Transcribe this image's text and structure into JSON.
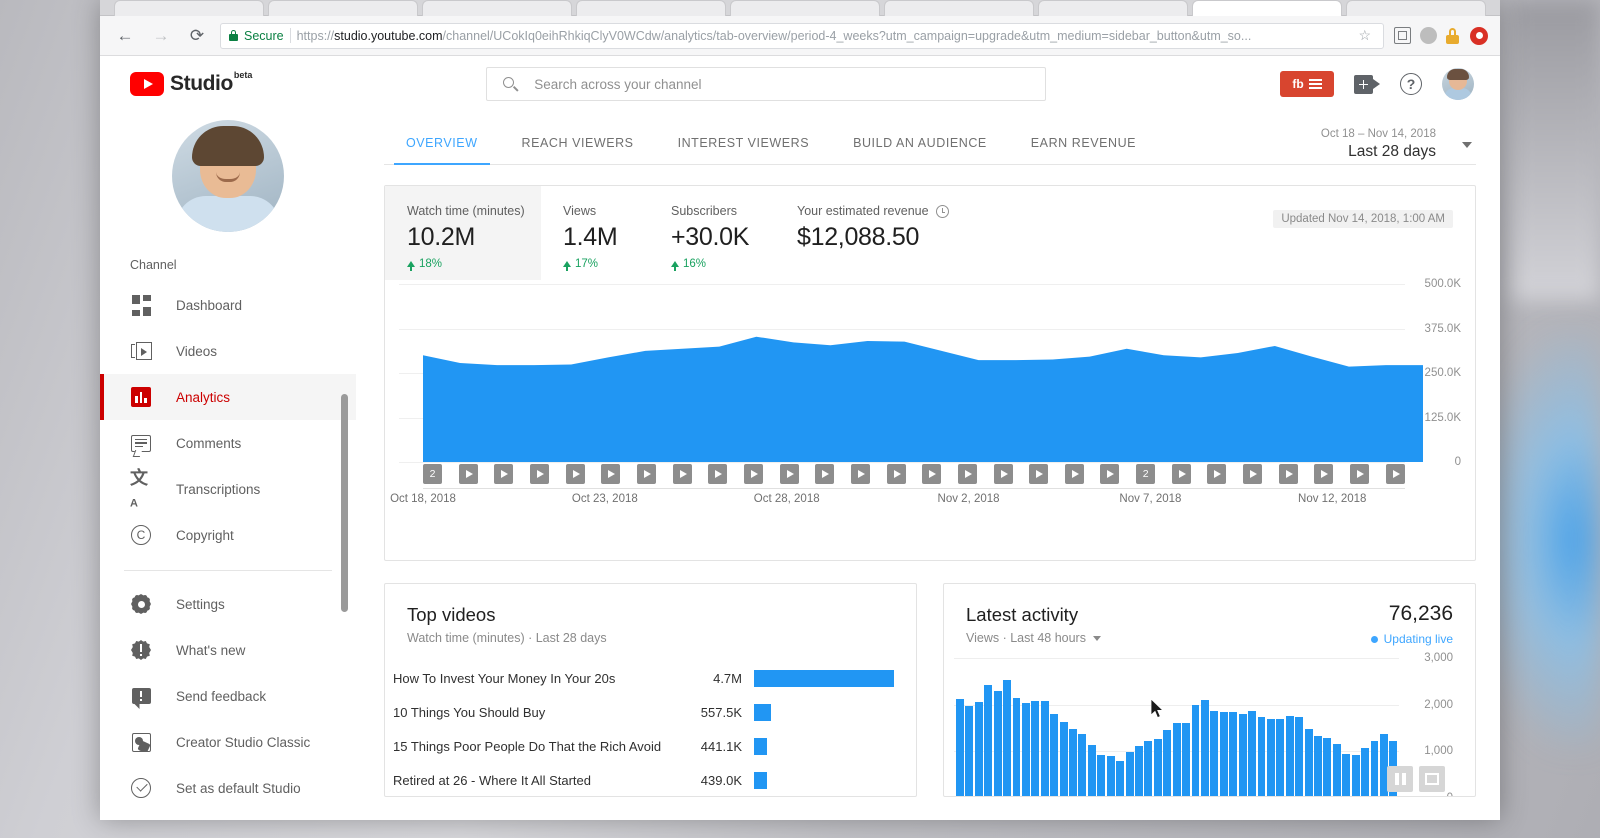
{
  "browser": {
    "back_icon": "back-arrow-icon",
    "forward_icon": "forward-arrow-icon",
    "reload_icon": "reload-icon",
    "secure_label": "Secure",
    "url_domain": "studio.youtube.com",
    "url_scheme": "https://",
    "url_path": "/channel/UCokIq0eihRhkiqClyV0WCdw/analytics/tab-overview/period-4_weeks?utm_campaign=upgrade&utm_medium=sidebar_button&utm_so...",
    "star_glyph": "☆"
  },
  "masthead": {
    "logo_text": "Studio",
    "logo_beta": "beta",
    "search_placeholder": "Search across your channel",
    "search_value": "",
    "extension_label": "fb",
    "create_video_icon": "video-camera-plus-icon",
    "help_glyph": "?",
    "avatar_name": "account-avatar"
  },
  "sidebar": {
    "section_label": "Channel",
    "items": [
      {
        "label": "Dashboard",
        "icon": "dashboard-icon",
        "active": false
      },
      {
        "label": "Videos",
        "icon": "videos-icon",
        "active": false
      },
      {
        "label": "Analytics",
        "icon": "analytics-icon",
        "active": true
      },
      {
        "label": "Comments",
        "icon": "comments-icon",
        "active": false
      },
      {
        "label": "Transcriptions",
        "icon": "transcriptions-icon",
        "active": false
      },
      {
        "label": "Copyright",
        "icon": "copyright-icon",
        "active": false
      }
    ],
    "items2": [
      {
        "label": "Settings",
        "icon": "gear-icon"
      },
      {
        "label": "What's new",
        "icon": "whats-new-icon"
      },
      {
        "label": "Send feedback",
        "icon": "feedback-icon"
      },
      {
        "label": "Creator Studio Classic",
        "icon": "creator-studio-classic-icon"
      },
      {
        "label": "Set as default Studio",
        "icon": "check-circle-icon"
      }
    ]
  },
  "tabs": [
    {
      "label": "OVERVIEW",
      "active": true
    },
    {
      "label": "REACH VIEWERS",
      "active": false
    },
    {
      "label": "INTEREST VIEWERS",
      "active": false
    },
    {
      "label": "BUILD AN AUDIENCE",
      "active": false
    },
    {
      "label": "EARN REVENUE",
      "active": false
    }
  ],
  "date_range": {
    "sub": "Oct 18 – Nov 14, 2018",
    "main": "Last 28 days"
  },
  "overview": {
    "updated": "Updated Nov 14, 2018, 1:00 AM",
    "metrics": [
      {
        "label": "Watch time (minutes)",
        "value": "10.2M",
        "delta": "18%",
        "selected": true
      },
      {
        "label": "Views",
        "value": "1.4M",
        "delta": "17%",
        "selected": false
      },
      {
        "label": "Subscribers",
        "value": "+30.0K",
        "delta": "16%",
        "selected": false
      },
      {
        "label": "Your estimated revenue",
        "value": "$12,088.50",
        "delta": "",
        "selected": false,
        "info_icon": "clock-icon"
      }
    ]
  },
  "top_videos": {
    "title": "Top videos",
    "subtitle": "Watch time (minutes) · Last 28 days",
    "rows": [
      {
        "name": "How To Invest Your Money In Your 20s",
        "value": "4.7M",
        "bar_pct": 100
      },
      {
        "name": "10 Things You Should Buy",
        "value": "557.5K",
        "bar_pct": 12
      },
      {
        "name": "15 Things Poor People Do That the Rich Avoid",
        "value": "441.1K",
        "bar_pct": 9.4
      },
      {
        "name": "Retired at 26 - Where It All Started",
        "value": "439.0K",
        "bar_pct": 9.3
      }
    ]
  },
  "latest_activity": {
    "title": "Latest activity",
    "subtitle": "Views · Last 48 hours",
    "count": "76,236",
    "live_label": "Updating live",
    "pause_icon": "pause-icon",
    "thumbnail_icon": "image-icon"
  },
  "chart_data": [
    {
      "type": "area",
      "title": "Watch time (minutes)",
      "xlabel": "",
      "ylabel": "",
      "ylim": [
        0,
        500000
      ],
      "yticks": [
        0,
        125000,
        250000,
        375000,
        500000
      ],
      "ytick_labels": [
        "0",
        "125.0K",
        "250.0K",
        "375.0K",
        "500.0K"
      ],
      "grid": true,
      "x_tick_labels": [
        "Oct 18, 2018",
        "Oct 23, 2018",
        "Oct 28, 2018",
        "Nov 2, 2018",
        "Nov 7, 2018",
        "Nov 12, 2018"
      ],
      "x_tick_index": [
        0,
        5,
        10,
        15,
        20,
        25
      ],
      "color": "#2196f3",
      "x": [
        "Oct 18",
        "Oct 19",
        "Oct 20",
        "Oct 21",
        "Oct 22",
        "Oct 23",
        "Oct 24",
        "Oct 25",
        "Oct 26",
        "Oct 27",
        "Oct 28",
        "Oct 29",
        "Oct 30",
        "Oct 31",
        "Nov 1",
        "Nov 2",
        "Nov 3",
        "Nov 4",
        "Nov 5",
        "Nov 6",
        "Nov 7",
        "Nov 8",
        "Nov 9",
        "Nov 10",
        "Nov 11",
        "Nov 12",
        "Nov 13",
        "Nov 14"
      ],
      "values": [
        300000,
        278000,
        272000,
        272000,
        274000,
        294000,
        312000,
        318000,
        324000,
        352000,
        336000,
        328000,
        340000,
        338000,
        312000,
        286000,
        286000,
        288000,
        296000,
        318000,
        300000,
        294000,
        306000,
        326000,
        296000,
        268000,
        272000,
        272000
      ],
      "markers": [
        {
          "index": 0,
          "label": "2"
        },
        {
          "index": 20,
          "label": "2"
        }
      ],
      "marker_icon": "video-play-marker"
    },
    {
      "type": "bar",
      "title": "Latest activity",
      "xlabel": "",
      "ylabel": "Views",
      "ylim": [
        0,
        3000
      ],
      "yticks": [
        0,
        1000,
        2000,
        3000
      ],
      "ytick_labels": [
        "0",
        "1,000",
        "2,000",
        "3,000"
      ],
      "grid": true,
      "color": "#2196f3",
      "values": [
        2080,
        1930,
        2010,
        2380,
        2260,
        2480,
        2100,
        1990,
        2030,
        2040,
        1760,
        1580,
        1440,
        1320,
        1090,
        880,
        860,
        760,
        940,
        1080,
        1180,
        1220,
        1420,
        1560,
        1560,
        1960,
        2060,
        1820,
        1790,
        1800,
        1760,
        1820,
        1700,
        1640,
        1640,
        1720,
        1700,
        1440,
        1280,
        1240,
        1110,
        900,
        880,
        1030,
        1180,
        1320,
        1180
      ]
    },
    {
      "type": "bar",
      "title": "Top videos",
      "orientation": "horizontal",
      "categories": [
        "How To Invest Your Money In Your 20s",
        "10 Things You Should Buy",
        "15 Things Poor People Do That the Rich Avoid",
        "Retired at 26 - Where It All Started"
      ],
      "values": [
        4700000,
        557500,
        441100,
        439000
      ],
      "value_labels": [
        "4.7M",
        "557.5K",
        "441.1K",
        "439.0K"
      ],
      "color": "#2196f3"
    }
  ]
}
